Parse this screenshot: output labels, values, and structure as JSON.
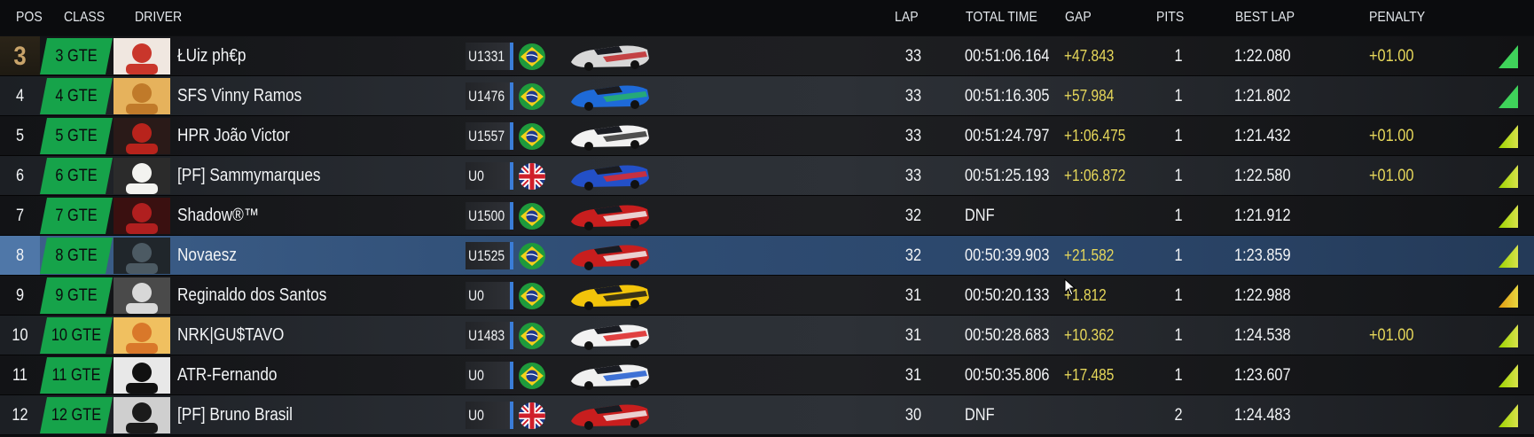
{
  "header": {
    "pos": "POS",
    "class": "CLASS",
    "driver": "DRIVER",
    "lap": "LAP",
    "total_time": "TOTAL TIME",
    "gap": "GAP",
    "pits": "PITS",
    "best_lap": "BEST LAP",
    "penalty": "PENALTY"
  },
  "colors": {
    "class_badge": "#16a34a",
    "gap_text": "#e6d75a",
    "selected_row": "#2f4d74"
  },
  "rows": [
    {
      "pos": "3",
      "class": "3 GTE",
      "driver": "ŁUiz ph€p",
      "car_no": "U1331",
      "flag": "brazil",
      "livery": "red-white",
      "lap": "33",
      "total": "00:51:06.164",
      "gap": "+47.843",
      "pits": "1",
      "best": "1:22.080",
      "penalty": "+01.00",
      "indicator": "green-icon"
    },
    {
      "pos": "4",
      "class": "4 GTE",
      "driver": "SFS Vinny Ramos",
      "car_no": "U1476",
      "flag": "brazil",
      "livery": "blue-green",
      "lap": "33",
      "total": "00:51:16.305",
      "gap": "+57.984",
      "pits": "1",
      "best": "1:21.802",
      "penalty": "",
      "indicator": "green-icon"
    },
    {
      "pos": "5",
      "class": "5 GTE",
      "driver": "HPR João Victor",
      "car_no": "U1557",
      "flag": "brazil",
      "livery": "white",
      "lap": "33",
      "total": "00:51:24.797",
      "gap": "+1:06.475",
      "pits": "1",
      "best": "1:21.432",
      "penalty": "+01.00",
      "indicator": "lime-icon"
    },
    {
      "pos": "6",
      "class": "6 GTE",
      "driver": "[PF] Sammymarques",
      "car_no": "U0",
      "flag": "uk",
      "livery": "blue-red",
      "lap": "33",
      "total": "00:51:25.193",
      "gap": "+1:06.872",
      "pits": "1",
      "best": "1:22.580",
      "penalty": "+01.00",
      "indicator": "lime-icon"
    },
    {
      "pos": "7",
      "class": "7 GTE",
      "driver": "Shadow®™",
      "car_no": "U1500",
      "flag": "brazil",
      "livery": "red",
      "lap": "32",
      "total": "DNF",
      "gap": "",
      "pits": "1",
      "best": "1:21.912",
      "penalty": "",
      "indicator": "lime-icon"
    },
    {
      "pos": "8",
      "class": "8 GTE",
      "driver": "Novaesz",
      "car_no": "U1525",
      "flag": "brazil",
      "livery": "red",
      "lap": "32",
      "total": "00:50:39.903",
      "gap": "+21.582",
      "pits": "1",
      "best": "1:23.859",
      "penalty": "",
      "indicator": "lime-icon",
      "selected": true
    },
    {
      "pos": "9",
      "class": "9 GTE",
      "driver": "Reginaldo dos Santos",
      "car_no": "U0",
      "flag": "brazil",
      "livery": "yellow",
      "lap": "31",
      "total": "00:50:20.133",
      "gap": "+1.812",
      "pits": "1",
      "best": "1:22.988",
      "penalty": "",
      "indicator": "amber-icon"
    },
    {
      "pos": "10",
      "class": "10 GTE",
      "driver": "NRK|GU$TAVO",
      "car_no": "U1483",
      "flag": "brazil",
      "livery": "white-red",
      "lap": "31",
      "total": "00:50:28.683",
      "gap": "+10.362",
      "pits": "1",
      "best": "1:24.538",
      "penalty": "+01.00",
      "indicator": "lime-icon"
    },
    {
      "pos": "11",
      "class": "11 GTE",
      "driver": "ATR-Fernando",
      "car_no": "U0",
      "flag": "brazil",
      "livery": "white-blue",
      "lap": "31",
      "total": "00:50:35.806",
      "gap": "+17.485",
      "pits": "1",
      "best": "1:23.607",
      "penalty": "",
      "indicator": "lime-icon"
    },
    {
      "pos": "12",
      "class": "12 GTE",
      "driver": "[PF] Bruno Brasil",
      "car_no": "U0",
      "flag": "uk",
      "livery": "red",
      "lap": "30",
      "total": "DNF",
      "gap": "",
      "pits": "2",
      "best": "1:24.483",
      "penalty": "",
      "indicator": "lime-icon"
    }
  ]
}
